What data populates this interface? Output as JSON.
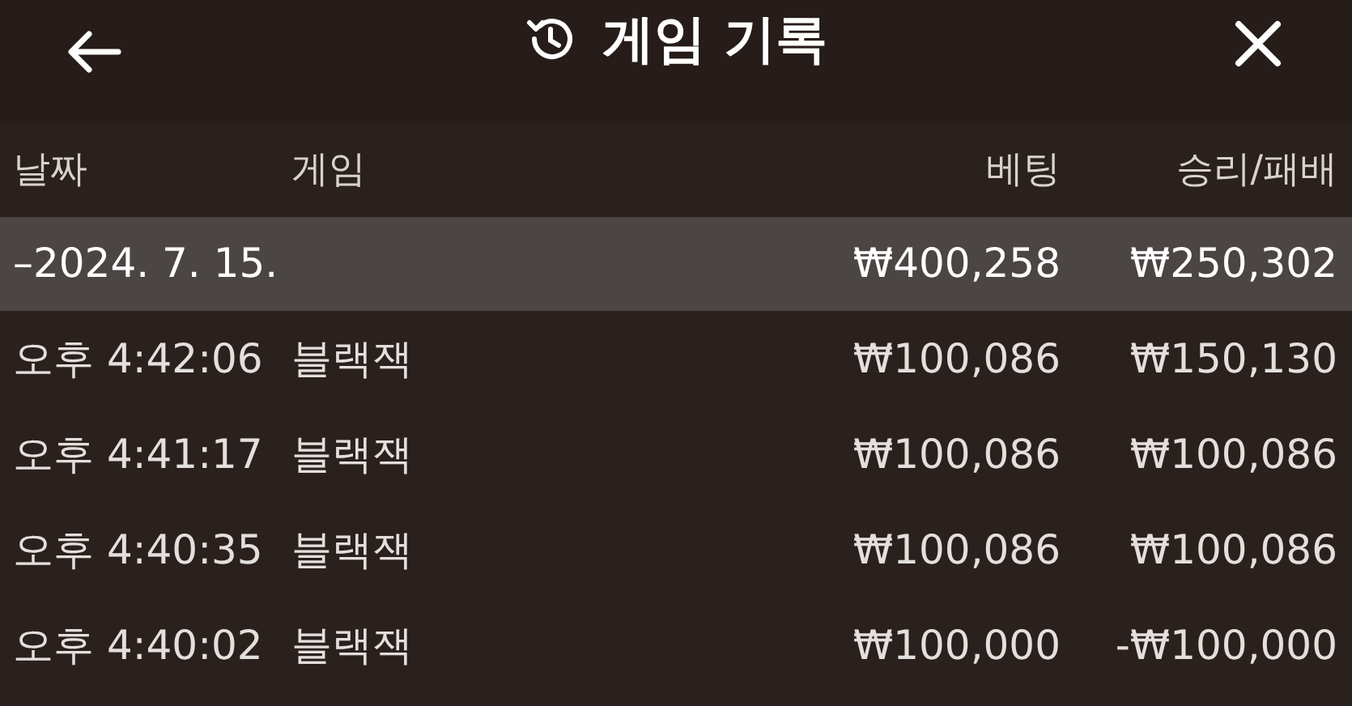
{
  "header": {
    "title": "게임 기록"
  },
  "columns": [
    "날짜",
    "게임",
    "베팅",
    "승리/패배"
  ],
  "group": {
    "date": "–2024. 7. 15.",
    "bet": "₩400,258",
    "result": "₩250,302"
  },
  "rows": [
    {
      "time": "오후 4:42:06",
      "game": "블랙잭",
      "bet": "₩100,086",
      "result": "₩150,130"
    },
    {
      "time": "오후 4:41:17",
      "game": "블랙잭",
      "bet": "₩100,086",
      "result": "₩100,086"
    },
    {
      "time": "오후 4:40:35",
      "game": "블랙잭",
      "bet": "₩100,086",
      "result": "₩100,086"
    },
    {
      "time": "오후 4:40:02",
      "game": "블랙잭",
      "bet": "₩100,000",
      "result": "-₩100,000"
    }
  ]
}
